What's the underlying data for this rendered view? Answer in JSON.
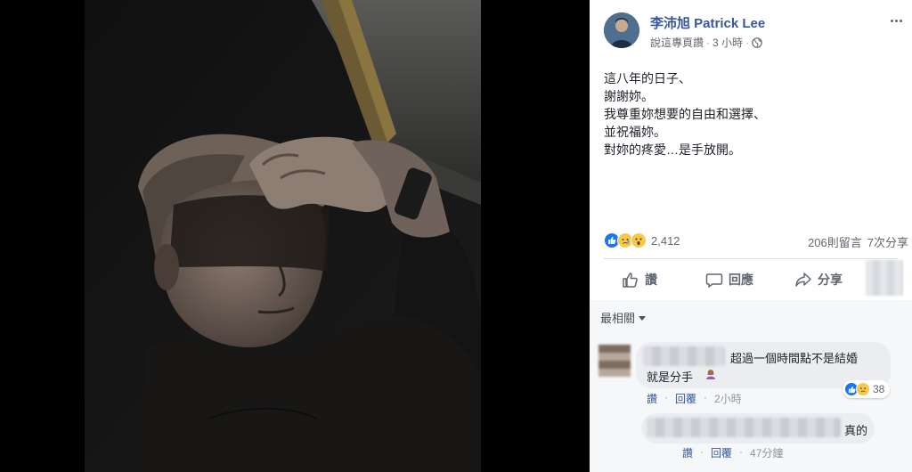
{
  "post": {
    "author": "李沛旭 Patrick Lee",
    "meta_text": "說這專頁讚",
    "meta_time": "3 小時",
    "text_lines": [
      "這八年的日子、",
      "謝謝妳。",
      "我尊重妳想要的自由和選擇、",
      "並祝福妳。",
      "對妳的疼愛…是手放開。"
    ]
  },
  "stats": {
    "reaction_count": "2,412",
    "comments": "206則留言",
    "shares": "7次分享"
  },
  "actions": {
    "like": "讚",
    "comment": "回應",
    "share": "分享"
  },
  "comments": {
    "sort_label": "最相關",
    "items": [
      {
        "text_line1": "超過一個時間點不是結婚",
        "text_line2": "就是分手",
        "like_label": "讚",
        "reply_label": "回覆",
        "time": "2小時",
        "reaction_count": "38"
      },
      {
        "text_line1": "真的",
        "like_label": "讚",
        "reply_label": "回覆",
        "time": "47分鐘"
      }
    ]
  },
  "colors": {
    "link": "#365899",
    "like_blue": "#1877f2",
    "sad_yellow": "#f7c94b"
  },
  "icons": [
    "globe-icon",
    "more-icon",
    "like-icon",
    "comment-icon",
    "share-icon",
    "caret-down-icon"
  ]
}
